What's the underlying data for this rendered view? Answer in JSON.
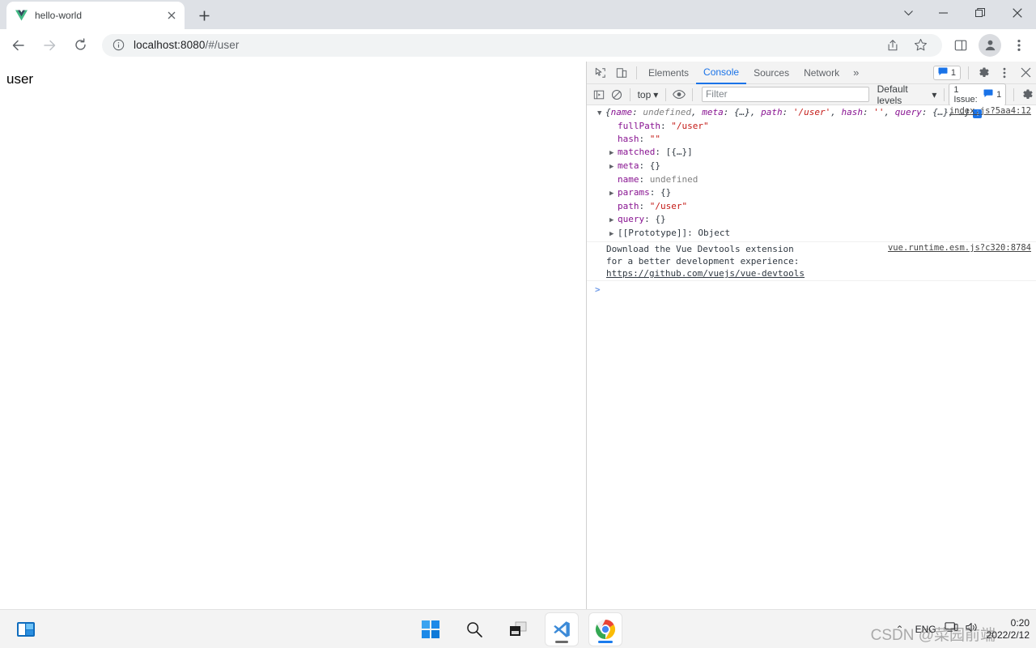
{
  "browser": {
    "tab": {
      "title": "hello-world",
      "favicon": "vue-logo-icon",
      "close": "×"
    },
    "new_tab_label": "+",
    "window_controls": {
      "dropdown": "⌄",
      "minimize": "—",
      "maximize": "❐",
      "close": "✕"
    },
    "nav": {
      "back": "←",
      "forward": "→",
      "reload": "⟳"
    },
    "omnibox": {
      "info_icon": "info-circle-icon",
      "host": "localhost:8080",
      "rest": "/#/user",
      "full_url": "localhost:8080/#/user",
      "share_icon": "share-icon",
      "bookmark_icon": "star-icon"
    },
    "toolbar_right": {
      "sidepanel_icon": "side-panel-icon",
      "profile_icon": "profile-avatar-icon",
      "menu_icon": "three-dot-menu-icon"
    }
  },
  "page": {
    "heading": "user"
  },
  "devtools": {
    "topbar": {
      "inspect_icon": "inspect-element-icon",
      "device_icon": "device-toolbar-icon",
      "tabs": [
        {
          "label": "Elements",
          "active": false
        },
        {
          "label": "Console",
          "active": true
        },
        {
          "label": "Sources",
          "active": false
        },
        {
          "label": "Network",
          "active": false
        }
      ],
      "more_tabs": "»",
      "message_count": "1",
      "message_icon": "message-bubble-icon",
      "settings_icon": "gear-icon",
      "kebab_icon": "three-dot-menu-icon",
      "close_icon": "close-icon"
    },
    "filterbar": {
      "sidebar_icon": "console-sidebar-icon",
      "clear_icon": "clear-console-icon",
      "context": "top",
      "context_caret": "▾",
      "eye_icon": "live-expression-icon",
      "filter_placeholder": "Filter",
      "filter_value": "",
      "levels": "Default levels",
      "levels_caret": "▾",
      "issues_label": "1 Issue:",
      "issues_count": "1",
      "issues_icon": "message-bubble-icon",
      "settings_icon": "gear-icon"
    },
    "console": {
      "messages": [
        {
          "type": "object",
          "source": "index.js?5aa4:12",
          "triangle": "▼",
          "head": {
            "open": "{",
            "parts": [
              {
                "key": "name",
                "sep": ": ",
                "value": "undefined",
                "value_kind": "undefined",
                "after": ", "
              },
              {
                "key": "meta",
                "sep": ": ",
                "value": "{…}",
                "value_kind": "plain",
                "after": ", "
              },
              {
                "key": "path",
                "sep": ": ",
                "value": "'/user'",
                "value_kind": "string",
                "after": ", "
              },
              {
                "key": "hash",
                "sep": ": ",
                "value": "''",
                "value_kind": "string",
                "after": ", "
              },
              {
                "key": "query",
                "sep": ": ",
                "value": "{…}",
                "value_kind": "plain",
                "after": ", "
              },
              {
                "key": "",
                "sep": "",
                "value": "…",
                "value_kind": "plain",
                "after": ""
              }
            ],
            "close": "}",
            "badge": "i"
          },
          "props": [
            {
              "triangle": "",
              "key": "fullPath",
              "value": "\"/user\"",
              "kind": "string"
            },
            {
              "triangle": "",
              "key": "hash",
              "value": "\"\"",
              "kind": "string"
            },
            {
              "triangle": "▶",
              "key": "matched",
              "value": "[{…}]",
              "kind": "plain"
            },
            {
              "triangle": "▶",
              "key": "meta",
              "value": "{}",
              "kind": "plain"
            },
            {
              "triangle": "",
              "key": "name",
              "value": "undefined",
              "kind": "undefined"
            },
            {
              "triangle": "▶",
              "key": "params",
              "value": "{}",
              "kind": "plain"
            },
            {
              "triangle": "",
              "key": "path",
              "value": "\"/user\"",
              "kind": "string"
            },
            {
              "triangle": "▶",
              "key": "query",
              "value": "{}",
              "kind": "plain"
            },
            {
              "triangle": "▶",
              "key": "[[Prototype]]",
              "value": "Object",
              "kind": "plain"
            }
          ]
        },
        {
          "type": "text",
          "source": "vue.runtime.esm.js?c320:8784",
          "text": "Download the Vue Devtools extension for a better development experience:",
          "link": "https://github.com/vuejs/vue-devtools"
        }
      ],
      "prompt_caret": ">"
    }
  },
  "taskbar": {
    "left_icon": "windows-widgets-icon",
    "center_icons": [
      {
        "name": "start-windows-icon",
        "active": false
      },
      {
        "name": "search-icon",
        "active": false
      },
      {
        "name": "task-view-icon",
        "active": false
      },
      {
        "name": "vscode-icon",
        "active": true
      },
      {
        "name": "chrome-icon",
        "active": true
      }
    ],
    "tray": {
      "chevron": "⌃",
      "language": "ENG",
      "network_icon": "network-icon",
      "volume_icon": "volume-icon",
      "time": "0:20",
      "date": "2022/2/12"
    },
    "watermark": "CSDN @菜园前端"
  }
}
